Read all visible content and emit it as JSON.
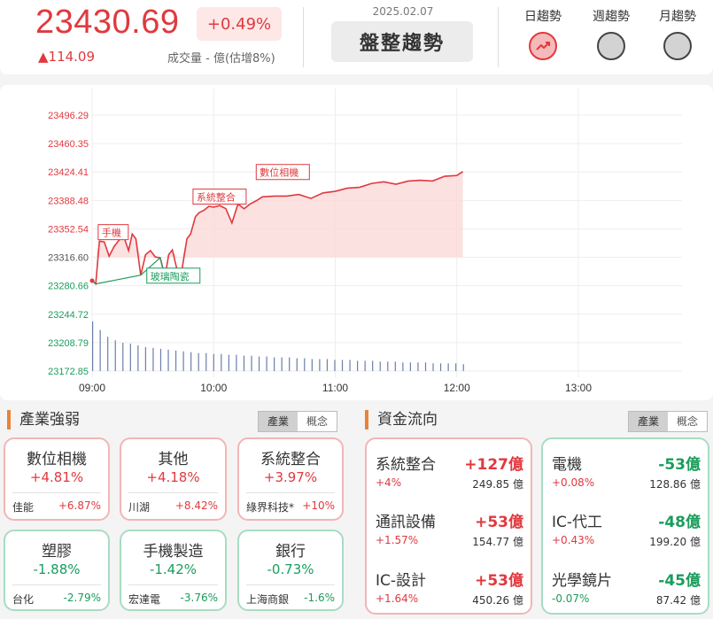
{
  "header": {
    "index_value": "23430.69",
    "change_pct": "+0.49%",
    "change_pts": "▲114.09",
    "volume_label": "成交量 - 億(估增8%)",
    "date": "2025.02.07",
    "trend_label": "盤整趨勢",
    "trend_tabs": [
      "日趨勢",
      "週趨勢",
      "月趨勢"
    ],
    "active_trend": 0
  },
  "chart_data": {
    "type": "line",
    "y_ticks": [
      "23496.29",
      "23460.35",
      "23424.41",
      "23388.48",
      "23352.54",
      "23316.60",
      "23280.66",
      "23244.72",
      "23208.79",
      "23172.85"
    ],
    "x_ticks": [
      "09:00",
      "10:00",
      "11:00",
      "12:00",
      "13:00"
    ],
    "reference": 23316.6,
    "ylim": [
      23172.85,
      23496.29
    ],
    "x_range_hours": [
      9.0,
      13.5
    ],
    "annotations": [
      {
        "label": "數位相機",
        "time": 10.35,
        "value": 23416
      },
      {
        "label": "系統整合",
        "time": 9.83,
        "value": 23385
      },
      {
        "label": "手機",
        "time": 9.05,
        "value": 23340
      },
      {
        "label": "玻璃陶瓷",
        "time": 9.45,
        "value": 23285
      }
    ],
    "price_series": [
      [
        9.0,
        23287
      ],
      [
        9.03,
        23283
      ],
      [
        9.06,
        23337
      ],
      [
        9.1,
        23336
      ],
      [
        9.14,
        23318
      ],
      [
        9.18,
        23330
      ],
      [
        9.22,
        23338
      ],
      [
        9.26,
        23343
      ],
      [
        9.3,
        23325
      ],
      [
        9.33,
        23346
      ],
      [
        9.36,
        23340
      ],
      [
        9.4,
        23294
      ],
      [
        9.44,
        23320
      ],
      [
        9.48,
        23325
      ],
      [
        9.52,
        23317
      ],
      [
        9.56,
        23316
      ],
      [
        9.6,
        23292
      ],
      [
        9.63,
        23320
      ],
      [
        9.66,
        23326
      ],
      [
        9.7,
        23300
      ],
      [
        9.74,
        23302
      ],
      [
        9.78,
        23340
      ],
      [
        9.81,
        23346
      ],
      [
        9.85,
        23368
      ],
      [
        9.88,
        23373
      ],
      [
        9.92,
        23376
      ],
      [
        9.96,
        23381
      ],
      [
        10.0,
        23380
      ],
      [
        10.05,
        23382
      ],
      [
        10.1,
        23378
      ],
      [
        10.15,
        23360
      ],
      [
        10.2,
        23384
      ],
      [
        10.25,
        23378
      ],
      [
        10.3,
        23384
      ],
      [
        10.35,
        23388
      ],
      [
        10.4,
        23393
      ],
      [
        10.5,
        23394
      ],
      [
        10.6,
        23394
      ],
      [
        10.7,
        23396
      ],
      [
        10.8,
        23391
      ],
      [
        10.9,
        23398
      ],
      [
        11.0,
        23400
      ],
      [
        11.1,
        23404
      ],
      [
        11.2,
        23405
      ],
      [
        11.3,
        23410
      ],
      [
        11.4,
        23412
      ],
      [
        11.5,
        23409
      ],
      [
        11.6,
        23413
      ],
      [
        11.7,
        23414
      ],
      [
        11.8,
        23413
      ],
      [
        11.9,
        23419
      ],
      [
        12.0,
        23420
      ],
      [
        12.05,
        23425
      ]
    ],
    "volume_series": [
      58,
      48,
      40,
      36,
      33,
      32,
      30,
      28,
      27,
      26,
      25,
      24,
      23,
      22,
      21,
      21,
      20,
      20,
      19,
      19,
      18,
      18,
      17,
      17,
      16,
      16,
      16,
      15,
      15,
      14,
      14,
      14,
      13,
      13,
      13,
      12,
      12,
      12,
      11,
      11,
      11,
      10,
      10,
      10,
      10,
      9,
      9,
      9,
      9,
      8
    ]
  },
  "industry": {
    "title": "產業強弱",
    "toggle": [
      "產業",
      "概念"
    ],
    "cards": [
      {
        "name": "數位相機",
        "pct": "+4.81%",
        "stock": "佳能",
        "stock_pct": "+6.87%",
        "dir": "up"
      },
      {
        "name": "其他",
        "pct": "+4.18%",
        "stock": "川湖",
        "stock_pct": "+8.42%",
        "dir": "up"
      },
      {
        "name": "系統整合",
        "pct": "+3.97%",
        "stock": "綠界科技*",
        "stock_pct": "+10%",
        "dir": "up"
      },
      {
        "name": "塑膠",
        "pct": "-1.88%",
        "stock": "台化",
        "stock_pct": "-2.79%",
        "dir": "down"
      },
      {
        "name": "手機製造",
        "pct": "-1.42%",
        "stock": "宏達電",
        "stock_pct": "-3.76%",
        "dir": "down"
      },
      {
        "name": "銀行",
        "pct": "-0.73%",
        "stock": "上海商銀",
        "stock_pct": "-1.6%",
        "dir": "down"
      }
    ]
  },
  "capital": {
    "title": "資金流向",
    "toggle": [
      "產業",
      "概念"
    ],
    "inflow": [
      {
        "name": "系統整合",
        "amount": "+127億",
        "pct": "+4%",
        "volume": "249.85 億"
      },
      {
        "name": "通訊設備",
        "amount": "+53億",
        "pct": "+1.57%",
        "volume": "154.77 億"
      },
      {
        "name": "IC-設計",
        "amount": "+53億",
        "pct": "+1.64%",
        "volume": "450.26 億"
      }
    ],
    "outflow": [
      {
        "name": "電機",
        "amount": "-53億",
        "pct": "+0.08%",
        "volume": "128.86 億"
      },
      {
        "name": "IC-代工",
        "amount": "-48億",
        "pct": "+0.43%",
        "volume": "199.20 億"
      },
      {
        "name": "光學鏡片",
        "amount": "-45億",
        "pct": "-0.07%",
        "volume": "87.42 億"
      }
    ]
  },
  "colors": {
    "up": "#e0393e",
    "down": "#1a9c5c",
    "accent": "#e8833a"
  }
}
